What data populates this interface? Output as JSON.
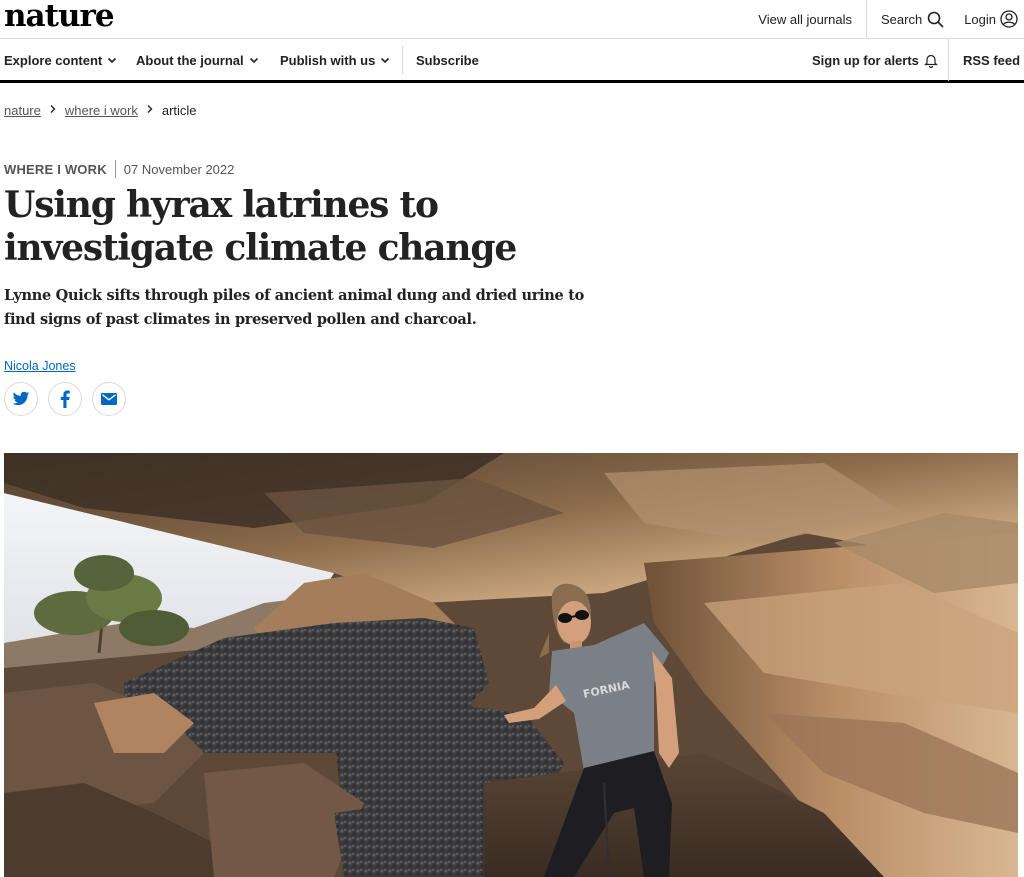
{
  "topbar": {
    "logo": "nature",
    "view_all_journals": "View all journals",
    "search": "Search",
    "login": "Login"
  },
  "nav": {
    "explore": "Explore content",
    "about": "About the journal",
    "publish": "Publish with us",
    "subscribe": "Subscribe",
    "alerts": "Sign up for alerts",
    "rss": "RSS feed"
  },
  "breadcrumb": {
    "items": [
      "nature",
      "where i work",
      "article"
    ]
  },
  "article": {
    "type": "WHERE I WORK",
    "date": "07 November 2022",
    "title": "Using hyrax latrines to investigate climate change",
    "standfirst": "Lynne Quick sifts through piles of ancient animal dung and dried urine to find signs of past climates in preserved pollen and charcoal.",
    "author": "Nicola Jones"
  },
  "icons": {
    "share": [
      "twitter-icon",
      "facebook-icon",
      "email-icon"
    ],
    "search": "search-icon",
    "login": "user-icon",
    "alerts": "bell-icon"
  },
  "colors": {
    "link_blue": "#0067c5",
    "share_blue": "#0067c5",
    "text": "#222222"
  }
}
